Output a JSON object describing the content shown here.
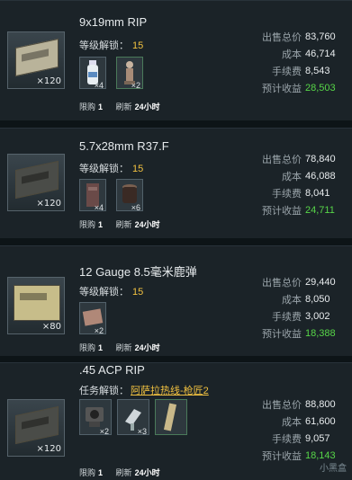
{
  "labels": {
    "level_unlock": "等级解锁：",
    "task_unlock": "任务解锁：",
    "limit": "限购",
    "refresh": "刷新",
    "sale_total": "出售总价",
    "cost": "成本",
    "fee": "手续费",
    "profit": "预计收益"
  },
  "items": [
    {
      "name": "9x19mm RIP",
      "unlock_value": "15",
      "thumb_qty": "×120",
      "reqs": [
        {
          "icon": "water-bottle-icon",
          "qty": "×4"
        },
        {
          "icon": "figurine-icon",
          "qty": "×2"
        }
      ],
      "limit": "1",
      "refresh": "24小时",
      "sale_total": "83,760",
      "cost": "46,714",
      "fee": "8,543",
      "profit": "28,503"
    },
    {
      "name": "5.7x28mm R37.F",
      "unlock_value": "15",
      "thumb_qty": "×120",
      "reqs": [
        {
          "icon": "case-icon",
          "qty": "×4"
        },
        {
          "icon": "pot-icon",
          "qty": "×6"
        }
      ],
      "limit": "1",
      "refresh": "24小时",
      "sale_total": "78,840",
      "cost": "46,088",
      "fee": "8,041",
      "profit": "24,711"
    },
    {
      "name": "12 Gauge 8.5毫米鹿弹",
      "unlock_value": "15",
      "thumb_qty": "×80",
      "reqs": [
        {
          "icon": "cloth-icon",
          "qty": "×2"
        }
      ],
      "limit": "1",
      "refresh": "24小时",
      "sale_total": "29,440",
      "cost": "8,050",
      "fee": "3,002",
      "profit": "18,388"
    },
    {
      "name": ".45 ACP RIP",
      "unlock_value": "阿萨拉热线-枪匠2",
      "thumb_qty": "×120",
      "reqs": [
        {
          "icon": "camera-icon",
          "qty": "×2"
        },
        {
          "icon": "drill-icon",
          "qty": "×3"
        },
        {
          "icon": "tape-icon",
          "qty": ""
        }
      ],
      "limit": "1",
      "refresh": "24小时",
      "sale_total": "88,800",
      "cost": "61,600",
      "fee": "9,057",
      "profit": "18,143"
    }
  ],
  "watermark": "小黑盒",
  "colors": {
    "profit": "#57d648",
    "unlock": "#f0c040",
    "card": "#1b2328",
    "page": "#0d1417"
  }
}
